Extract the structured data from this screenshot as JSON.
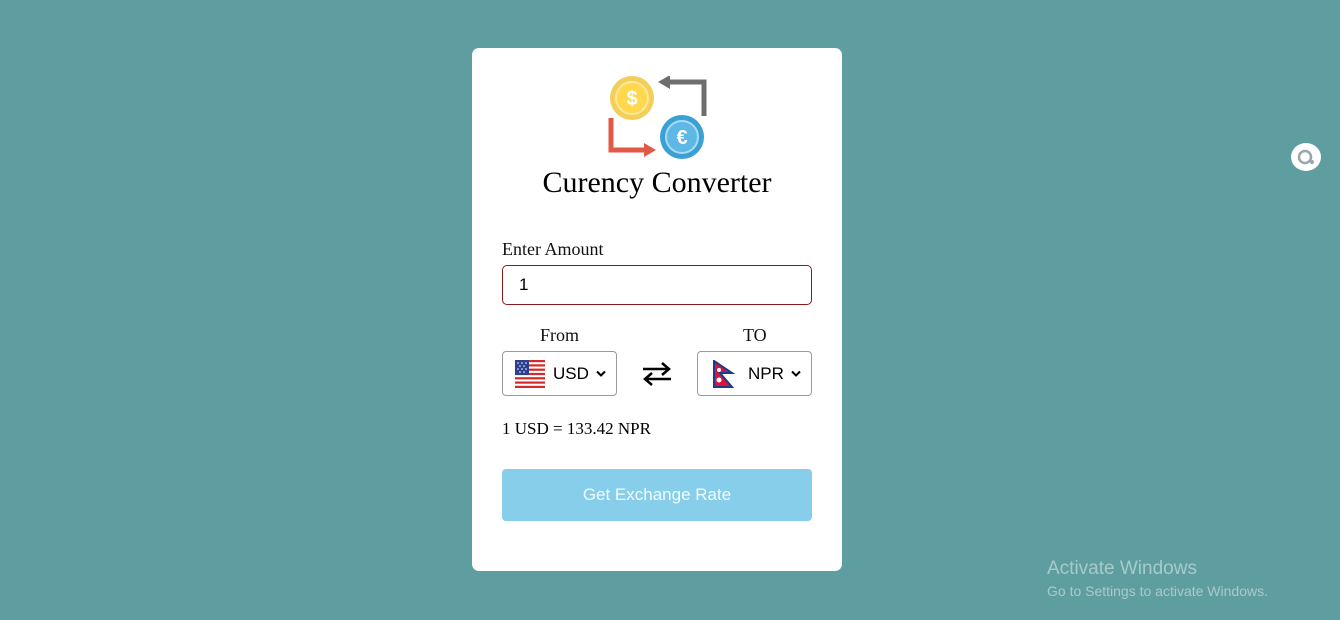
{
  "app": {
    "title": "Curency Converter"
  },
  "form": {
    "amount_label": "Enter Amount",
    "amount_value": "1",
    "from_label": "From",
    "to_label": "TO",
    "from_currency": "USD",
    "to_currency": "NPR",
    "rate_text": "1 USD = 133.42 NPR",
    "submit_label": "Get Exchange Rate"
  },
  "icons": {
    "logo": "currency-exchange-icon",
    "swap": "swap-arrows-icon",
    "from_flag": "us-flag-icon",
    "to_flag": "nepal-flag-icon",
    "dropdown": "chevron-down-icon",
    "extension": "extension-icon"
  },
  "colors": {
    "background": "#5f9ea0",
    "card": "#ffffff",
    "button": "#87ceeb",
    "input_border": "#8b1a1a"
  },
  "watermark": {
    "title": "Activate Windows",
    "subtitle": "Go to Settings to activate Windows."
  }
}
